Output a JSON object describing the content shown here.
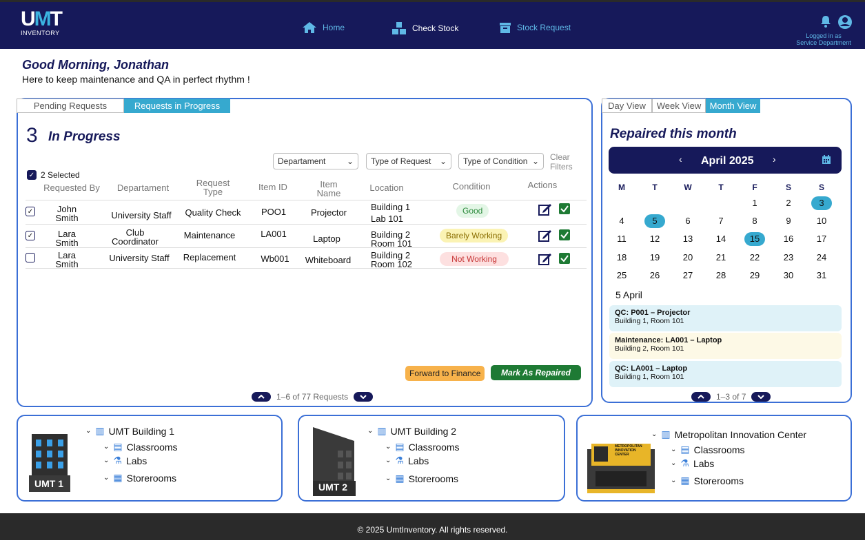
{
  "app": {
    "logo_text": "UMT",
    "logo_sub": "INVENTORY"
  },
  "nav": {
    "home": "Home",
    "check_stock": "Check Stock",
    "stock_request": "Stock Request"
  },
  "user": {
    "logged_in_line1": "Logged in as",
    "logged_in_line2": "Service Department"
  },
  "greeting": {
    "title": "Good Morning, Jonathan",
    "subtitle": "Here to keep maintenance and QA in perfect rhythm !"
  },
  "requests": {
    "tabs": [
      "Pending Requests",
      "Requests in Progress"
    ],
    "count": "3",
    "count_label": "In Progress",
    "filters": [
      "Departament",
      "Type of Request",
      "Type of Condition"
    ],
    "clear_filters": [
      "Clear",
      "Filters"
    ],
    "selected": "2 Selected",
    "headers": {
      "requested_by": "Requested By",
      "department": "Departament",
      "request_type_1": "Request",
      "request_type_2": "Type",
      "item_id": "Item ID",
      "item_name_1": "Item",
      "item_name_2": "Name",
      "location": "Location",
      "condition": "Condition",
      "actions": "Actions"
    },
    "rows": [
      {
        "first": "John",
        "last": "Smith",
        "dept1": "University Staff",
        "dept2": "",
        "type": "Quality Check",
        "id": "POO1",
        "name": "Projector",
        "loc1": "Building 1",
        "loc2": "Lab 101",
        "condition": "Good",
        "checked": true
      },
      {
        "first": "Lara",
        "last": "Smith",
        "dept1": "Club",
        "dept2": "Coordinator",
        "type": "Maintenance",
        "id": "LA001",
        "name": "Laptop",
        "loc1": "Building 2",
        "loc2": "Room 101",
        "condition": "Barely Working",
        "checked": true
      },
      {
        "first": "Lara",
        "last": "Smith",
        "dept1": "University Staff",
        "dept2": "",
        "type": "Replacement",
        "id": "Wb001",
        "name": "Whiteboard",
        "loc1": "Building 2",
        "loc2": "Room 102",
        "condition": "Not Working",
        "checked": false
      }
    ],
    "forward_btn": "Forward to Finance",
    "repaired_btn": "Mark As Repaired",
    "pager": "1–6 of 77 Requests"
  },
  "calendar": {
    "views": [
      "Day View",
      "Week View",
      "Month View"
    ],
    "title": "Repaired this month",
    "month": "April 2025",
    "dow": [
      "M",
      "T",
      "W",
      "T",
      "F",
      "S",
      "S"
    ],
    "weeks": [
      [
        "",
        "",
        "",
        "",
        "1",
        "2",
        "3"
      ],
      [
        "4",
        "5",
        "6",
        "7",
        "8",
        "9",
        "10"
      ],
      [
        "11",
        "12",
        "13",
        "14",
        "15",
        "16",
        "17"
      ],
      [
        "18",
        "19",
        "20",
        "21",
        "22",
        "23",
        "24"
      ],
      [
        "25",
        "26",
        "27",
        "28",
        "29",
        "30",
        "31"
      ]
    ],
    "highlighted": [
      "3",
      "5",
      "15"
    ],
    "selected_date": "5 April",
    "events": [
      {
        "title": "QC: P001 – Projector",
        "place": "Building 1, Room 101",
        "color": "#dff2f8"
      },
      {
        "title": "Maintenance: LA001 – Laptop",
        "place": "Building 2, Room 101",
        "color": "#fdf9e6"
      },
      {
        "title": "QC: LA001 – Laptop",
        "place": "Building 1, Room 101",
        "color": "#dff2f8"
      }
    ],
    "pager": "1–3 of 7"
  },
  "buildings": [
    {
      "name": "UMT Building 1",
      "image_label": "UMT 1",
      "items": [
        "Classrooms",
        "Labs",
        "Storerooms"
      ]
    },
    {
      "name": "UMT Building 2",
      "image_label": "UMT 2",
      "items": [
        "Classrooms",
        "Labs",
        "Storerooms"
      ]
    },
    {
      "name": "Metropolitan Innovation Center",
      "image_label": "METROPOLITAN INNOVATION CENTER",
      "items": [
        "Classrooms",
        "Labs",
        "Storerooms"
      ]
    }
  ],
  "footer": "© 2025 UmtInventory. All rights reserved.",
  "colors": {
    "navy": "#16195a",
    "accent": "#36a9cf",
    "border": "#3b6fd6",
    "good_bg": "#e3f6e6",
    "good_fg": "#2e8b3e",
    "barely_bg": "#fbf3b4",
    "barely_fg": "#8a6d00",
    "not_bg": "#fde0e0",
    "not_fg": "#c63333",
    "forward_bg": "#f7b24b",
    "repaired_bg": "#1e7a34"
  }
}
